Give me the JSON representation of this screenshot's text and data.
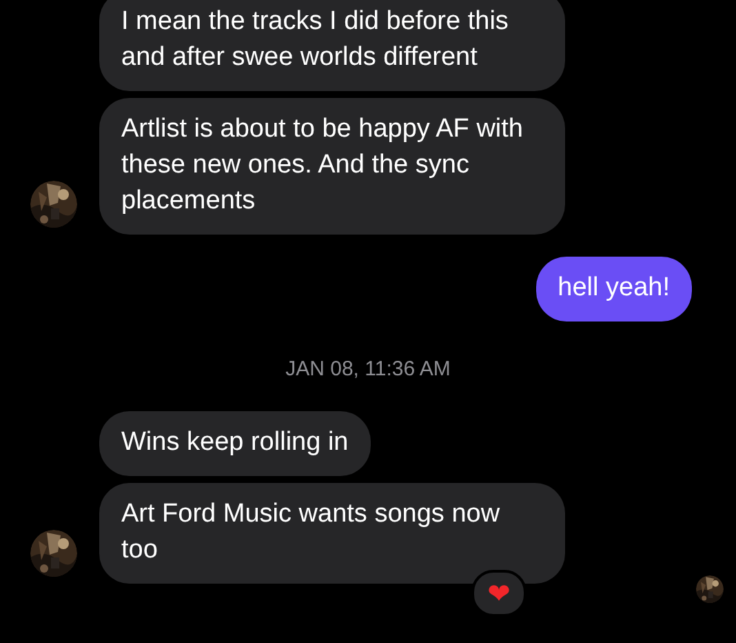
{
  "messages": [
    {
      "kind": "incoming",
      "text": "I mean the tracks I did before this and after swee worlds different",
      "avatar": false
    },
    {
      "kind": "incoming",
      "text": "Artlist is about to be happy AF with these new ones. And the sync placements",
      "avatar": true
    },
    {
      "kind": "outgoing",
      "text": "hell yeah!"
    },
    {
      "kind": "timestamp",
      "text": "JAN 08, 11:36 AM"
    },
    {
      "kind": "incoming",
      "text": "Wins keep rolling in",
      "avatar": false
    },
    {
      "kind": "incoming",
      "text": "Art Ford Music wants songs now too",
      "avatar": true,
      "reaction": "❤"
    }
  ],
  "read_receipt": true
}
